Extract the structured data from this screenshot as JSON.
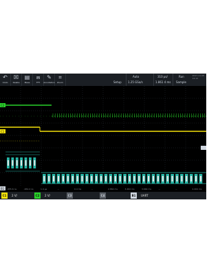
{
  "toolbar": {
    "items": [
      {
        "label": "Undo",
        "icon": "undo-icon",
        "glyph": "↶"
      },
      {
        "label": "Delete",
        "icon": "trash-icon",
        "glyph": "☒"
      },
      {
        "label": "Meas",
        "icon": "ruler-icon",
        "glyph": "▤"
      },
      {
        "label": "FFT",
        "icon": "fft-icon",
        "glyph": "⩎"
      },
      {
        "label": "Annotation",
        "icon": "pen-icon",
        "glyph": "✎"
      },
      {
        "label": "Zoom",
        "icon": "zoom-icon",
        "glyph": "⌗"
      }
    ]
  },
  "header": {
    "setup": "Setup",
    "trigger_mode": "Auto",
    "sample_rate": "1.25 GSa/s",
    "time_div": "310 µs/",
    "record": "1.861 4 ms",
    "run_state": "Run",
    "acq_mode": "Sample",
    "clock_date": "2017-11-08",
    "clock_time": "14:12"
  },
  "channels": [
    {
      "label": "C1",
      "scale": "2 V/",
      "color": "#f5e20b"
    },
    {
      "label": "C2",
      "scale": "2 V/",
      "color": "#29d32a"
    },
    {
      "label": "C3",
      "scale": "",
      "color": "#c8c8c8"
    },
    {
      "label": "C4",
      "scale": "",
      "color": "#c8c8c8"
    }
  ],
  "bus": {
    "label": "B1",
    "protocol": "UART"
  },
  "time_ticks": [
    "-955.6 ns",
    "-954.4 ns",
    "1.4 µs",
    "...",
    "0.4 ms",
    "...",
    "2.864 ms",
    "3.264 ms",
    "3.664 ms",
    "...",
    "...",
    "2.264 ms"
  ],
  "colors": {
    "bg": "#000000",
    "ch1": "#f5e20b",
    "ch2": "#29d32a",
    "bus": "#28b6a6",
    "grid": "#2a2f36"
  }
}
